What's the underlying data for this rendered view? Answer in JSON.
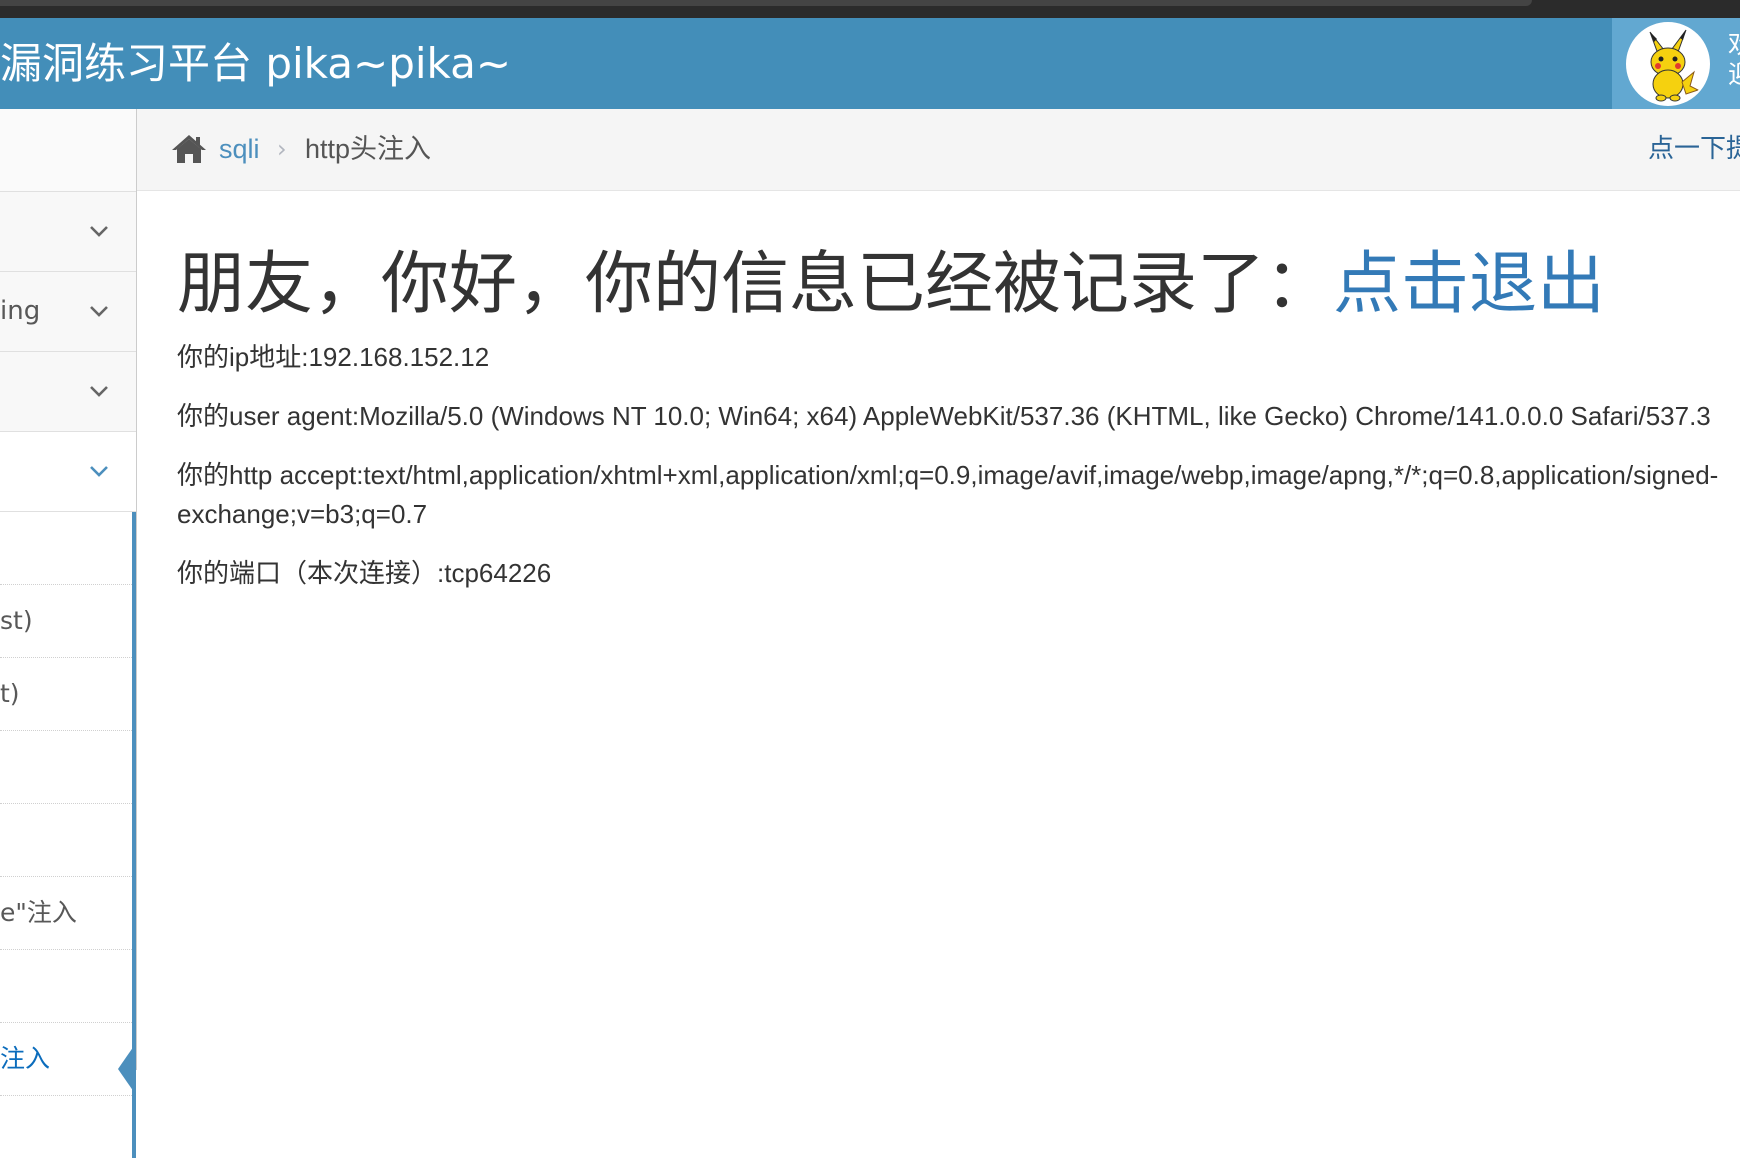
{
  "brand": {
    "title_visible": "漏洞练习平台 pika~pika~"
  },
  "user": {
    "welcome_partial": "欢迎"
  },
  "sidebar": {
    "items": [
      {
        "label": ""
      },
      {
        "label": "ing"
      },
      {
        "label": ""
      },
      {
        "label": ""
      }
    ],
    "subitems": [
      {
        "label": ""
      },
      {
        "label": "st)"
      },
      {
        "label": "t)"
      },
      {
        "label": ""
      },
      {
        "label": ""
      },
      {
        "label": "e\"注入"
      },
      {
        "label": ""
      },
      {
        "label": "注入"
      }
    ]
  },
  "breadcrumb": {
    "home_icon": "home-icon",
    "link": "sqli",
    "separator": "›",
    "current": "http头注入",
    "right_link": "点一下提"
  },
  "main": {
    "headline": "朋友，你好，你的信息已经被记录了：",
    "logout_link": "点击退出",
    "ip_line": "你的ip地址:192.168.152.12",
    "ua_line": "你的user agent:Mozilla/5.0 (Windows NT 10.0; Win64; x64) AppleWebKit/537.36 (KHTML, like Gecko) Chrome/141.0.0.0 Safari/537.3",
    "accept_line": "你的http accept:text/html,application/xhtml+xml,application/xml;q=0.9,image/avif,image/webp,image/apng,*/*;q=0.8,application/signed-exchange;v=b3;q=0.7",
    "port_line": "你的端口（本次连接）:tcp64226"
  },
  "colors": {
    "navbar": "#438eb9",
    "user_box": "#62a8d1",
    "link": "#337ab7",
    "active_bar": "#4c8fbd"
  }
}
